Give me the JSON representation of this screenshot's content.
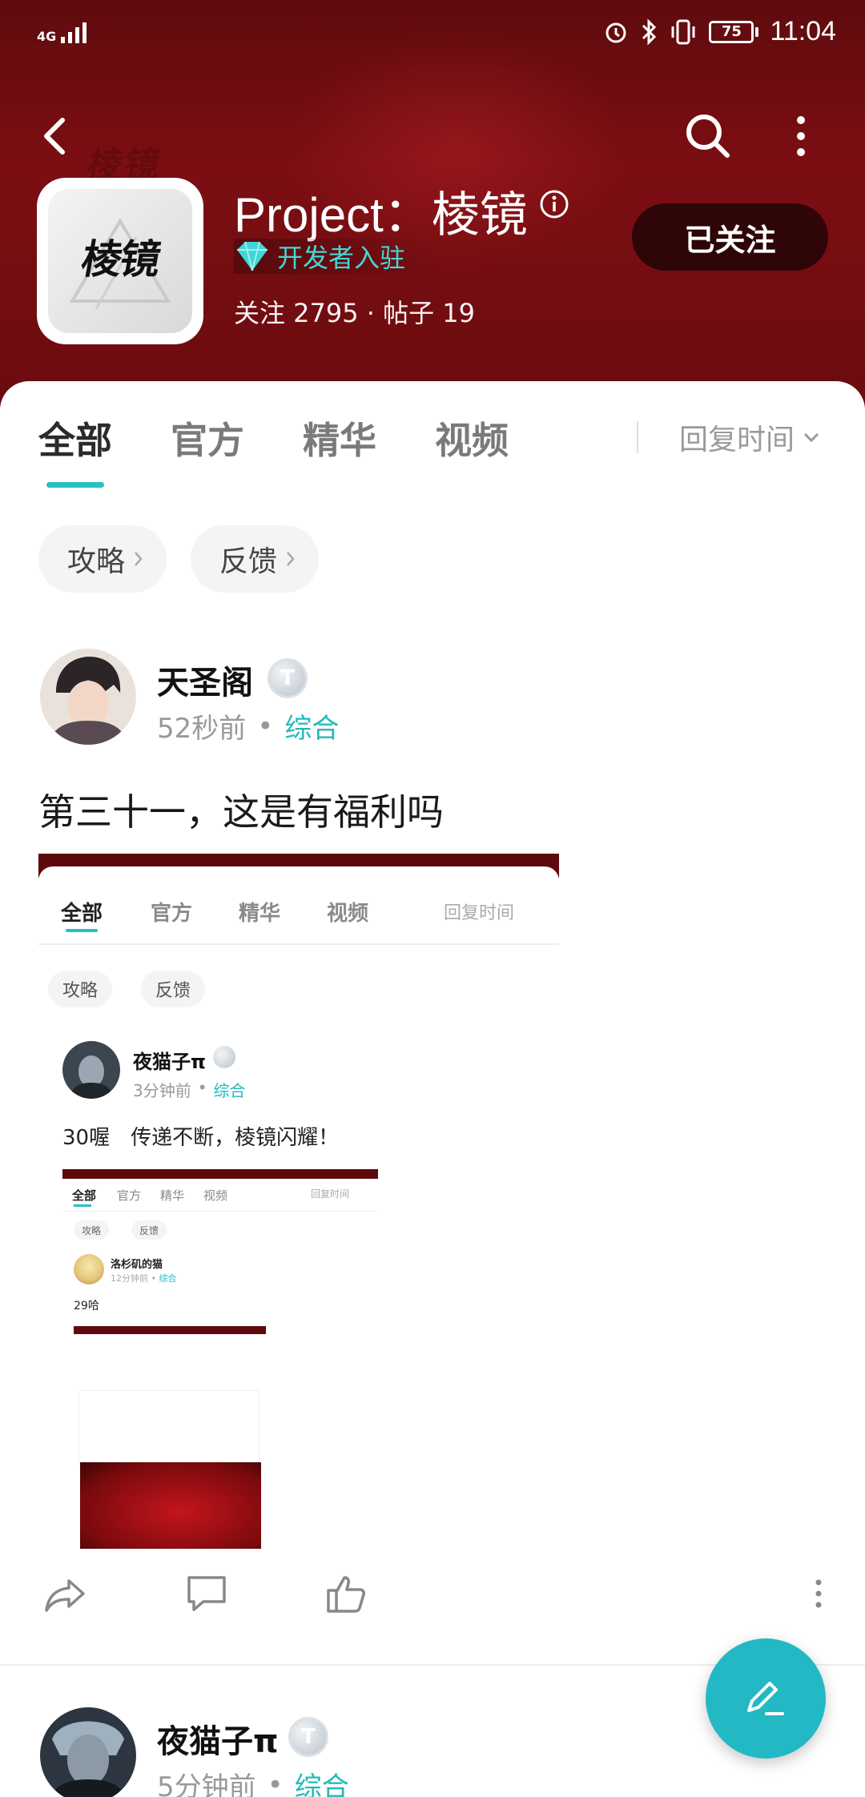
{
  "status_bar": {
    "network": "4G",
    "battery": "75",
    "time": "11:04"
  },
  "header": {
    "app_icon_text": "棱镜",
    "title": "Project：棱镜",
    "badge": "开发者入驻",
    "stats": "关注 2795 · 帖子 19",
    "follow_label": "已关注",
    "colors": {
      "header_bg": "#6a0c10",
      "accent": "#26c1c1"
    }
  },
  "tabs": [
    {
      "label": "全部",
      "active": true
    },
    {
      "label": "官方",
      "active": false
    },
    {
      "label": "精华",
      "active": false
    },
    {
      "label": "视频",
      "active": false
    }
  ],
  "sort_label": "回复时间",
  "chips": [
    "攻略",
    "反馈"
  ],
  "posts": [
    {
      "username": "天圣阁",
      "level": "T",
      "time": "52秒前",
      "category": "综合",
      "text": "第三十一，这是有福利吗",
      "screenshot": {
        "tabs": [
          "全部",
          "官方",
          "精华",
          "视频"
        ],
        "sort_label": "回复时间",
        "chips": [
          "攻略",
          "反馈"
        ],
        "username": "夜猫子π",
        "time": "3分钟前",
        "category": "综合",
        "text": "30喔　传递不断，棱镜闪耀！",
        "nested": {
          "tabs": [
            "全部",
            "官方",
            "精华",
            "视频"
          ],
          "sort_label": "回复时间",
          "chips": [
            "攻略",
            "反馈"
          ],
          "username": "洛杉矶的猫",
          "time": "12分钟前",
          "category": "综合",
          "text": "29哈"
        }
      }
    },
    {
      "username": "夜猫子π",
      "level": "T",
      "time": "5分钟前",
      "category": "综合"
    }
  ],
  "icons": [
    "back-icon",
    "search-icon",
    "more-icon",
    "info-icon",
    "diamond-icon",
    "share-icon",
    "comment-icon",
    "like-icon",
    "post-more-icon",
    "edit-icon"
  ]
}
